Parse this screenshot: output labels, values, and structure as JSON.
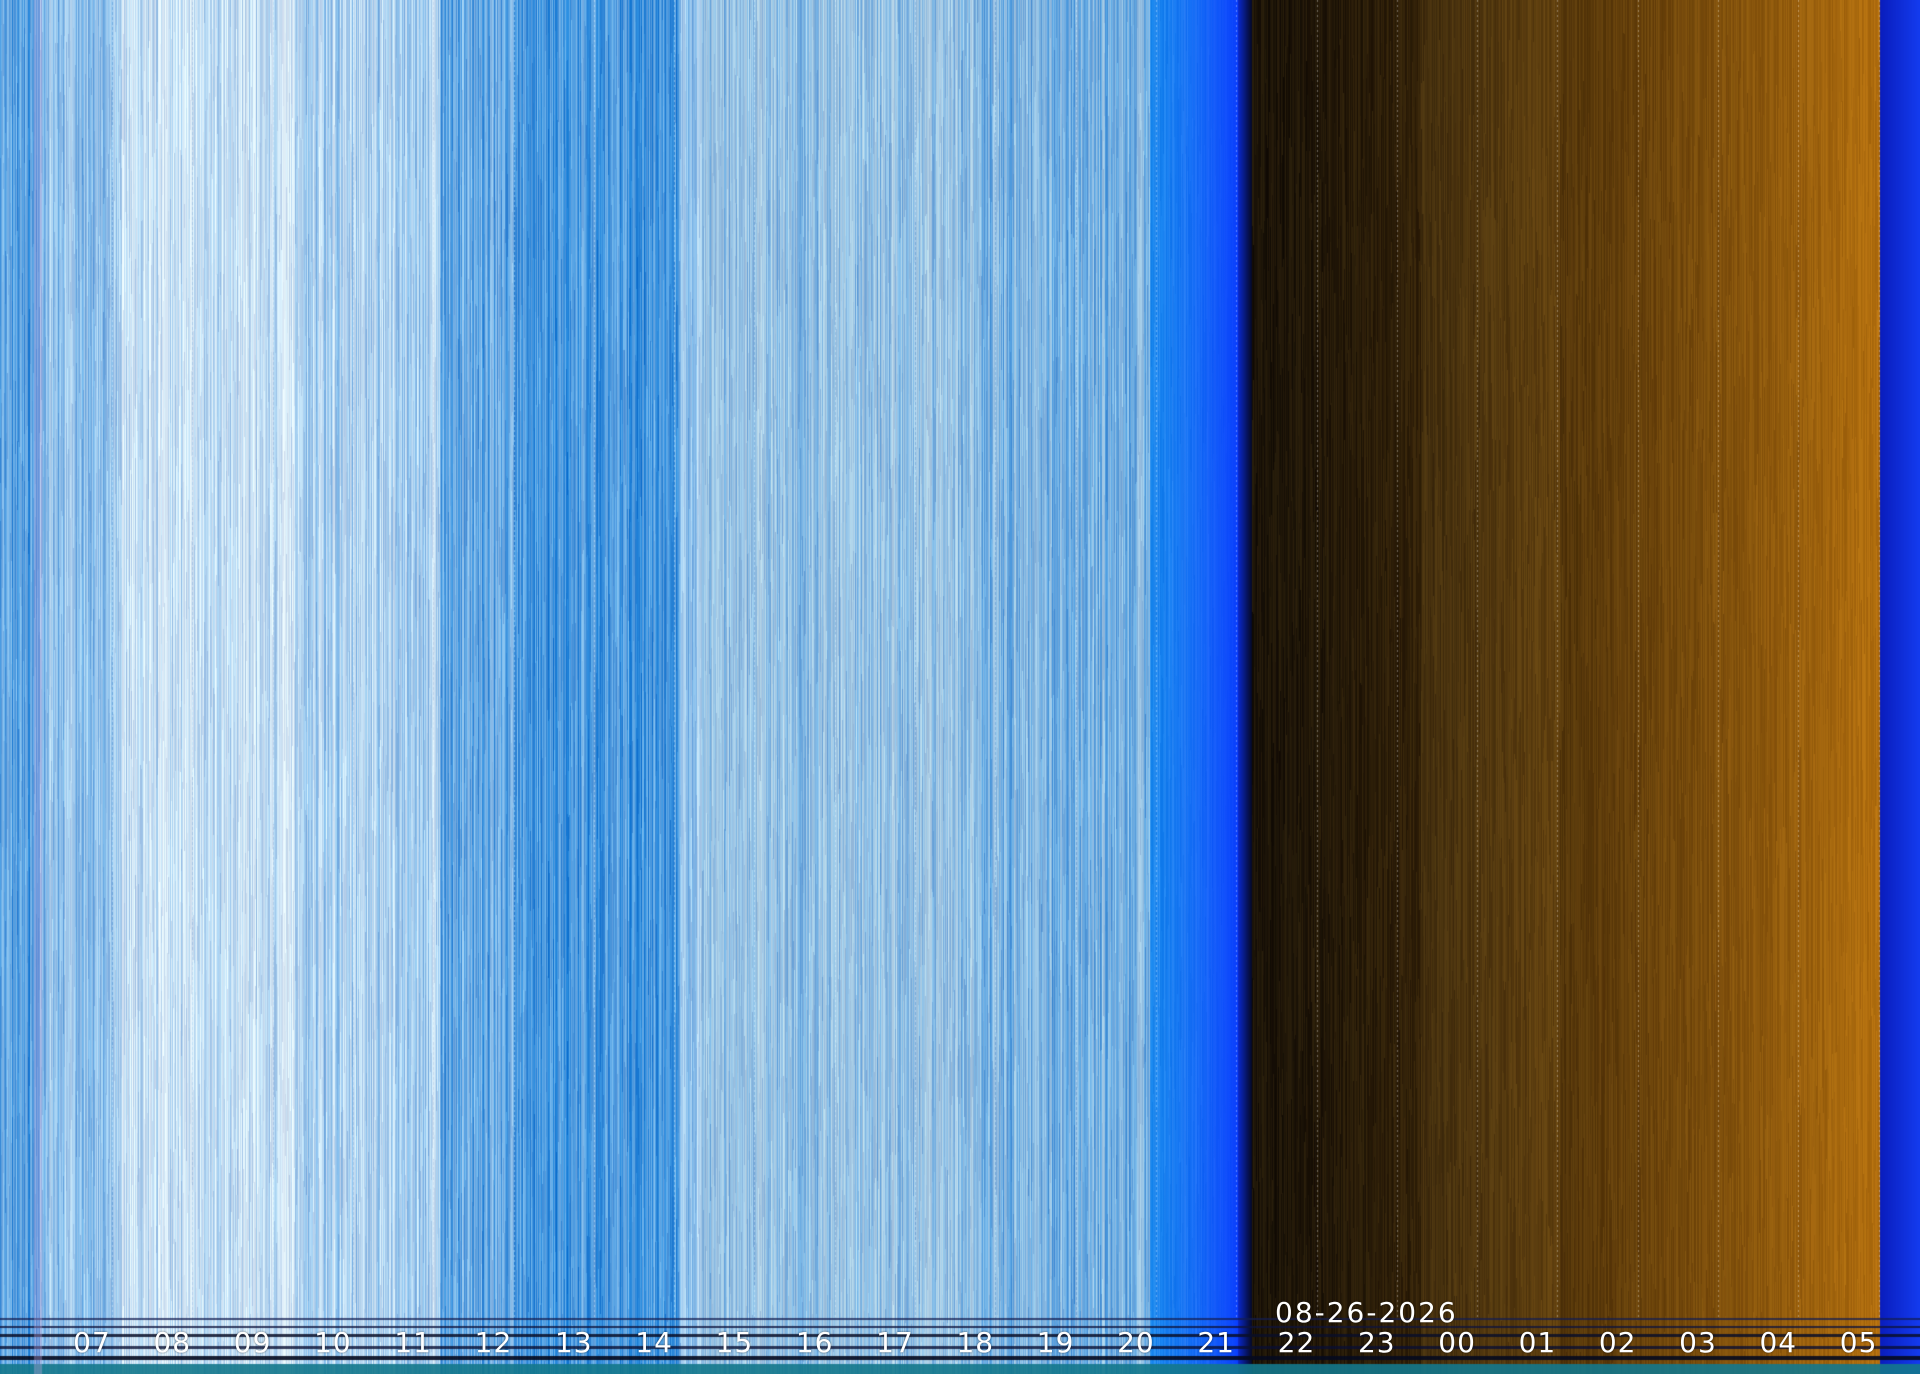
{
  "keogram": {
    "date": "08-26-2026",
    "hours": [
      "07",
      "08",
      "09",
      "10",
      "11",
      "12",
      "13",
      "14",
      "15",
      "16",
      "17",
      "18",
      "19",
      "20",
      "21",
      "22",
      "23",
      "00",
      "01",
      "02",
      "03",
      "04",
      "05"
    ],
    "colors": {
      "day_sky": "#1e7fd8",
      "day_highlight": "#e8f6ff",
      "day_cloud": "#a9c8d8",
      "dusk_blue": "#0a3cff",
      "night_dark": "#1a1208",
      "night_amber": "#b0700f",
      "label": "#ffffff"
    }
  }
}
